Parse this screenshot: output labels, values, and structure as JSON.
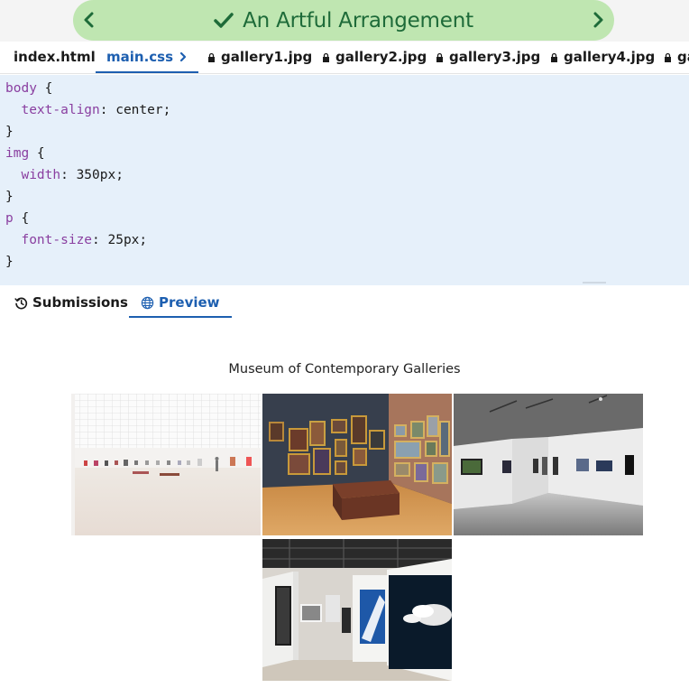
{
  "header": {
    "title": "An Artful Arrangement",
    "prev_icon": "chevron-left-icon",
    "next_icon": "chevron-right-icon",
    "check_icon": "check-icon",
    "accent_color": "#bfe6b1",
    "text_color": "#1e6b39"
  },
  "file_tabs": [
    {
      "label": "index.html",
      "locked": false,
      "active": false
    },
    {
      "label": "main.css",
      "locked": false,
      "active": true
    },
    {
      "label": "gallery1.jpg",
      "locked": true,
      "active": false
    },
    {
      "label": "gallery2.jpg",
      "locked": true,
      "active": false
    },
    {
      "label": "gallery3.jpg",
      "locked": true,
      "active": false
    },
    {
      "label": "gallery4.jpg",
      "locked": true,
      "active": false
    },
    {
      "label": "ga",
      "locked": true,
      "active": false
    }
  ],
  "code": {
    "l1_sel": "body",
    "l1_rest": " {",
    "l2_prop": "  text-align",
    "l2_rest": ": center;",
    "l3": "}",
    "l4_sel": "img",
    "l4_rest": " {",
    "l5_prop": "  width",
    "l5_rest": ": 350px;",
    "l6": "}",
    "l7_sel": "p",
    "l7_rest": " {",
    "l8_prop": "  font-size",
    "l8_rest": ": 25px;",
    "l9": "}"
  },
  "lower_tabs": {
    "submissions": "Submissions",
    "preview": "Preview",
    "active": "preview"
  },
  "preview": {
    "heading": "Museum of Contemporary Galleries",
    "images": [
      "gallery1.jpg",
      "gallery2.jpg",
      "gallery3.jpg",
      "gallery4.jpg"
    ]
  }
}
